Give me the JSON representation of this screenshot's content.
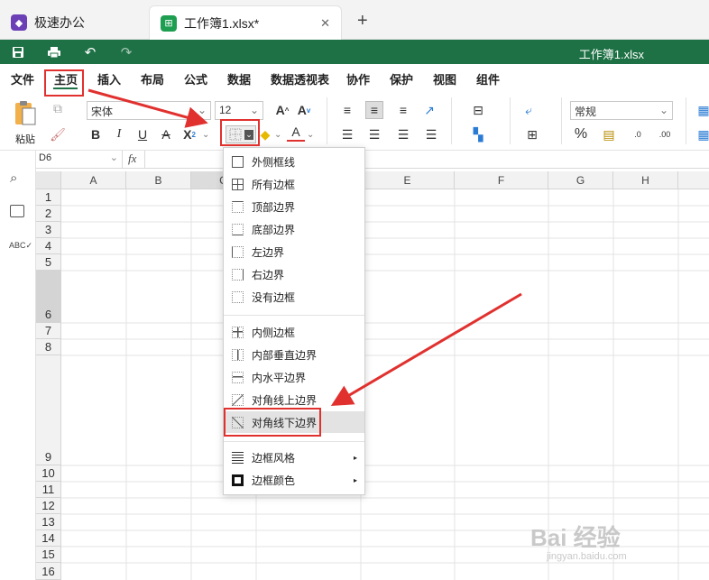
{
  "tabs": [
    {
      "label": "极速办公",
      "icon": "app-icon"
    },
    {
      "label": "工作簿1.xlsx*",
      "icon": "sheet-icon"
    }
  ],
  "new_tab_label": "+",
  "close_tab_label": "✕",
  "document_title": "工作簿1.xlsx",
  "menu": [
    "文件",
    "主页",
    "插入",
    "布局",
    "公式",
    "数据",
    "数据透视表",
    "协作",
    "保护",
    "视图",
    "组件"
  ],
  "toolbar": {
    "paste_label": "粘贴",
    "font_name": "宋体",
    "font_size": "12",
    "number_format": "常规",
    "bold": "B",
    "italic": "I",
    "underline": "U",
    "strike": "A",
    "subscript": "X",
    "grow_font": "A",
    "shrink_font": "A",
    "font_color": "A",
    "percent": "%"
  },
  "formula_bar": {
    "cell_ref": "D6",
    "fx": "fx"
  },
  "columns": [
    "A",
    "B",
    "C",
    "D",
    "E",
    "F",
    "G",
    "H"
  ],
  "rows": [
    "1",
    "2",
    "3",
    "4",
    "5",
    "6",
    "7",
    "8",
    "9",
    "10",
    "11",
    "12",
    "13",
    "14",
    "15",
    "16"
  ],
  "border_menu": {
    "group1": [
      "外侧框线",
      "所有边框",
      "顶部边界",
      "底部边界",
      "左边界",
      "右边界",
      "没有边框"
    ],
    "group2": [
      "内侧边框",
      "内部垂直边界",
      "内水平边界",
      "对角线上边界",
      "对角线下边界"
    ],
    "group3": [
      "边框风格",
      "边框颜色"
    ],
    "highlighted": "对角线下边界"
  },
  "colors": {
    "brand_green": "#1e7145",
    "annotation_red": "#e0312f",
    "active_tab_green": "#1e9e50"
  },
  "watermark": {
    "line1": "Bai 经验",
    "line2": "jingyan.baidu.com"
  }
}
